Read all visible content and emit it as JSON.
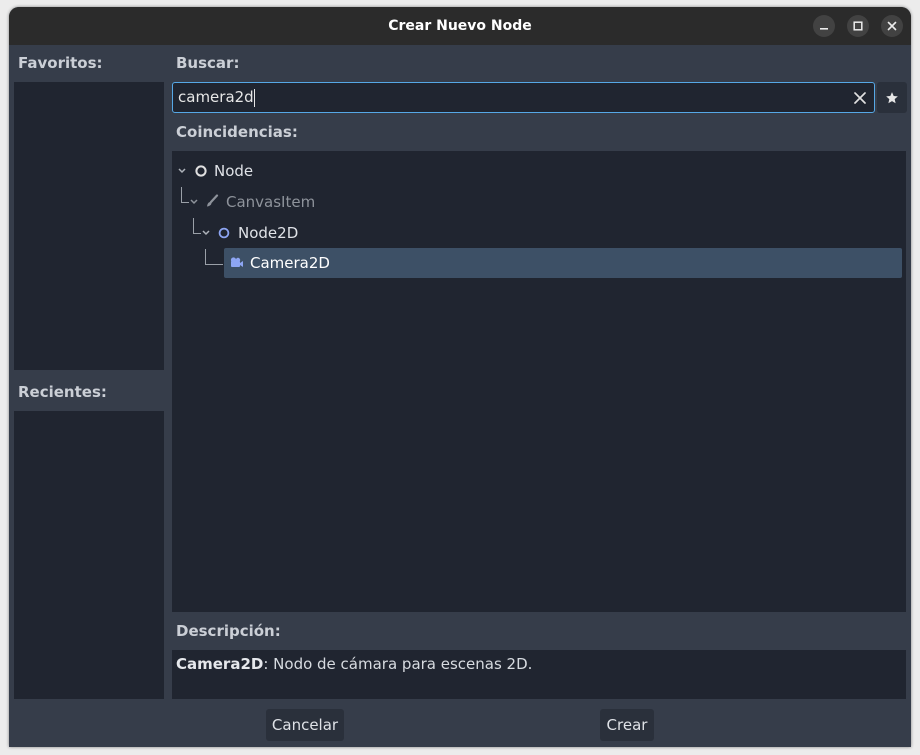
{
  "window": {
    "title": "Crear Nuevo Node"
  },
  "favorites": {
    "label": "Favoritos:"
  },
  "recents": {
    "label": "Recientes:"
  },
  "search": {
    "label": "Buscar:",
    "value": "camera2d"
  },
  "matches": {
    "label": "Coincidencias:",
    "tree": [
      {
        "label": "Node",
        "icon": "node-circle-icon",
        "depth": 0,
        "dim": false,
        "selected": false
      },
      {
        "label": "CanvasItem",
        "icon": "brush-icon",
        "depth": 1,
        "dim": true,
        "selected": false
      },
      {
        "label": "Node2D",
        "icon": "node2d-circle-icon",
        "depth": 2,
        "dim": false,
        "selected": false
      },
      {
        "label": "Camera2D",
        "icon": "camera-icon",
        "depth": 3,
        "dim": false,
        "selected": true
      }
    ]
  },
  "description": {
    "label": "Descripción:",
    "class_name": "Camera2D",
    "text": ": Nodo de cámara para escenas 2D."
  },
  "buttons": {
    "cancel": "Cancelar",
    "create": "Crear"
  },
  "colors": {
    "window_bg": "#363d4a",
    "panel_bg": "#202530",
    "accent": "#56a8e6",
    "selection": "#3d5066",
    "node2d_icon": "#8da5f3"
  }
}
